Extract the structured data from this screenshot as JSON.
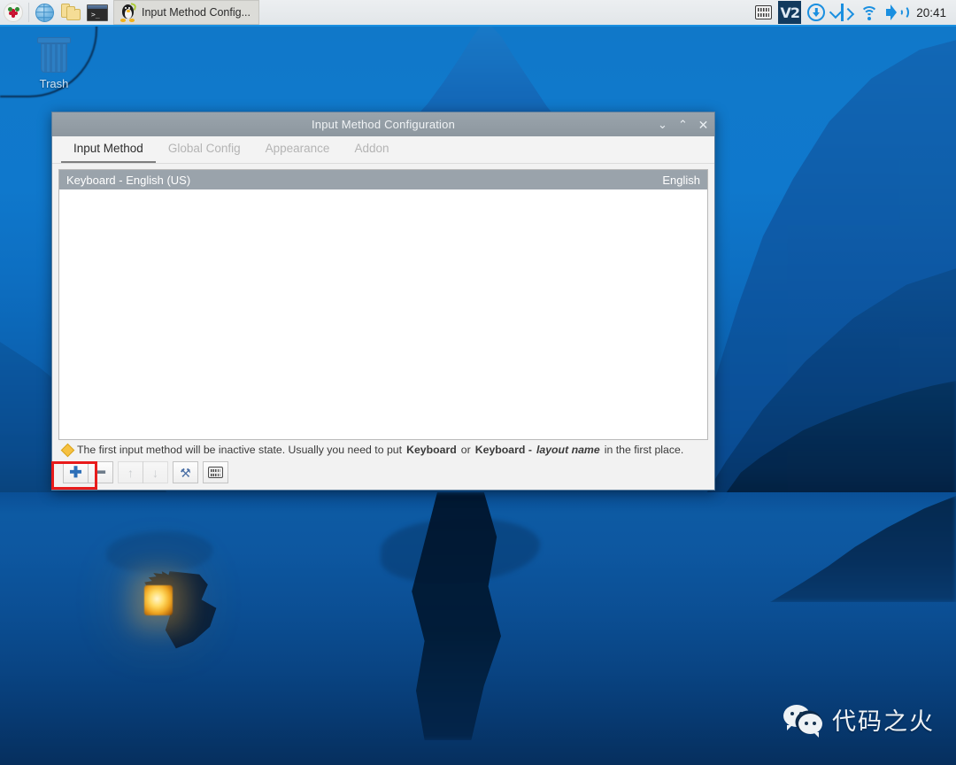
{
  "desktop": {
    "icons": [
      {
        "name": "trash",
        "label": "Trash"
      }
    ],
    "watermark": {
      "text": "代码之火",
      "logo": "wechat-logo"
    }
  },
  "taskbar": {
    "launchers": [
      {
        "name": "raspberry-menu",
        "icon": "raspberry-icon",
        "title": "Menu"
      },
      {
        "name": "web-browser",
        "icon": "globe-icon",
        "title": "Web Browser"
      },
      {
        "name": "file-manager",
        "icon": "folders-icon",
        "title": "File Manager"
      },
      {
        "name": "terminal",
        "icon": "terminal-icon",
        "title": "Terminal",
        "prompt": ">_"
      }
    ],
    "windows": [
      {
        "name": "window-button-input-method",
        "icon": "tux-icon",
        "label": "Input Method Config..."
      }
    ],
    "tray": [
      {
        "name": "tray-keyboard",
        "icon": "keyboard-icon"
      },
      {
        "name": "tray-vnc",
        "icon": "vnc-icon",
        "label": "V2"
      },
      {
        "name": "tray-updates",
        "icon": "download-circle-icon"
      },
      {
        "name": "tray-bluetooth",
        "icon": "bluetooth-icon"
      },
      {
        "name": "tray-wifi",
        "icon": "wifi-icon"
      },
      {
        "name": "tray-volume",
        "icon": "speaker-icon"
      }
    ],
    "clock": "20:41"
  },
  "dialog": {
    "title": "Input Method Configuration",
    "window_buttons": {
      "minimize": "⌄",
      "maximize": "⌃",
      "close": "✕"
    },
    "tabs": [
      {
        "label": "Input Method",
        "active": true
      },
      {
        "label": "Global Config",
        "active": false
      },
      {
        "label": "Appearance",
        "active": false
      },
      {
        "label": "Addon",
        "active": false
      }
    ],
    "input_methods": [
      {
        "name": "Keyboard - English (US)",
        "language": "English",
        "selected": true
      }
    ],
    "hint": {
      "icon": "warning-diamond-icon",
      "part1": "The first input method will be inactive state. Usually you need to put ",
      "bold1": "Keyboard",
      "mid": " or ",
      "bold2": "Keyboard - ",
      "italic": "layout name",
      "part2": " in the first place."
    },
    "toolbar": [
      {
        "name": "add-input-method-button",
        "icon": "plus-icon",
        "glyph": "✚",
        "enabled": true,
        "highlighted": true
      },
      {
        "name": "remove-input-method-button",
        "icon": "minus-icon",
        "glyph": "━",
        "enabled": true
      },
      {
        "name": "move-up-button",
        "icon": "arrow-up-icon",
        "glyph": "↑",
        "enabled": false
      },
      {
        "name": "move-down-button",
        "icon": "arrow-down-icon",
        "glyph": "↓",
        "enabled": false
      },
      {
        "name": "configure-button",
        "icon": "tools-icon",
        "glyph": "⚒",
        "enabled": true
      },
      {
        "name": "keyboard-layout-button",
        "icon": "keyboard-icon",
        "enabled": true
      }
    ]
  },
  "annotation": {
    "highlight_color": "#e81b1b",
    "target": "add-input-method-button"
  }
}
